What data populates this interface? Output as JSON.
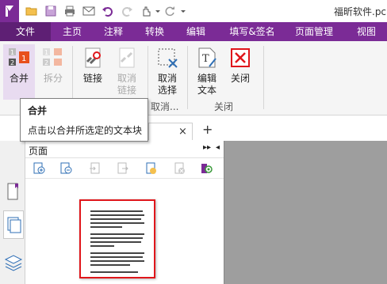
{
  "app": {
    "title": "福昕软件.pc"
  },
  "quick_access": {
    "icons": [
      "foxit-logo-icon",
      "open-folder-icon",
      "save-icon",
      "print-icon",
      "email-icon",
      "undo-icon",
      "redo-icon",
      "hand-tool-icon",
      "dropdown-icon",
      "customize-icon"
    ]
  },
  "tabs": [
    {
      "label": "文件",
      "active": true
    },
    {
      "label": "主页",
      "active": false
    },
    {
      "label": "注释",
      "active": false
    },
    {
      "label": "转换",
      "active": false
    },
    {
      "label": "编辑",
      "active": false
    },
    {
      "label": "填写&签名",
      "active": false
    },
    {
      "label": "页面管理",
      "active": false
    },
    {
      "label": "视图",
      "active": false
    }
  ],
  "ribbon": {
    "merge": "合并",
    "split": "拆分",
    "link": "链接",
    "unlink_line1": "取消",
    "unlink_line2": "链接",
    "deselect_line1": "取消",
    "deselect_line2": "选择",
    "edit_text_line1": "编辑",
    "edit_text_line2": "文本",
    "close": "关闭",
    "group_deselect": "取消...",
    "group_close": "关闭"
  },
  "tooltip": {
    "title": "合并",
    "description": "点击以合并所选定的文本块"
  },
  "doc_tab": {
    "close_glyph": "×",
    "new_tab_glyph": "+"
  },
  "panel": {
    "title": "页面",
    "expand_glyph": "▸▸",
    "collapse_glyph": "◂"
  },
  "colors": {
    "brand": "#7b2b96",
    "selection_border": "#e0161b",
    "workspace": "#9e9e9e"
  }
}
